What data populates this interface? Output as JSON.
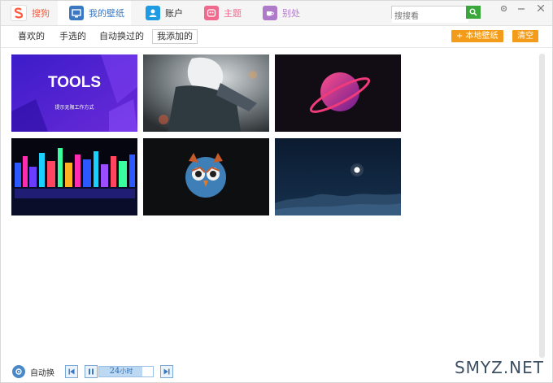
{
  "tabs": [
    {
      "label": "搜狗",
      "icon": "sogou-logo-icon",
      "color": "#ff5a3c"
    },
    {
      "label": "我的壁纸",
      "icon": "monitor-icon",
      "color": "#3a78c2"
    },
    {
      "label": "账户",
      "icon": "user-icon",
      "color": "#1f9be3"
    },
    {
      "label": "主题",
      "icon": "theme-icon",
      "color": "#f06a8e"
    },
    {
      "label": "别处",
      "icon": "cup-icon",
      "color": "#b07acb"
    }
  ],
  "search": {
    "placeholder": "搜搜看"
  },
  "subnav": {
    "items": [
      "喜欢的",
      "手选的",
      "自动换过的",
      "我添加的"
    ],
    "local_wallpaper": "+ 本地壁纸",
    "clear": "清空"
  },
  "thumbnails": [
    {
      "title": "TOOLS",
      "subtitle": "提示无限工作方式"
    },
    {
      "title": ""
    },
    {
      "title": ""
    },
    {
      "title": ""
    },
    {
      "title": ""
    },
    {
      "title": ""
    }
  ],
  "bottom": {
    "auto_label": "自动换",
    "time_value": "24",
    "time_unit": "小时"
  },
  "watermark": "SMYZ.NET",
  "colors": {
    "accent": "#f39c1b",
    "brand": "#3a78c2"
  }
}
